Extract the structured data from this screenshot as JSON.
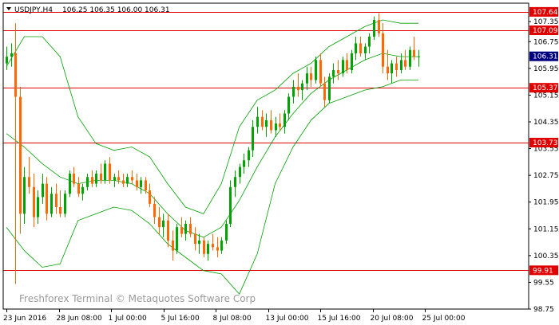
{
  "header": {
    "symbol": "USDJPY,H4",
    "ohlc": "106.25 106.35 106.00 106.31"
  },
  "watermark": "Freshforex Terminal © Metaquotes Software Corp",
  "colors": {
    "background": "#ffffff",
    "frame": "#000000",
    "bull_candle": "#00a400",
    "bear_candle": "#ff6a00",
    "level_line": "#e00000",
    "bollinger": "#00a000",
    "price_box": "#000080"
  },
  "chart_data": {
    "type": "candlestick",
    "ylim": [
      98.75,
      107.9
    ],
    "y_ticks": [
      "107.35",
      "106.75",
      "105.95",
      "105.15",
      "104.35",
      "103.55",
      "102.75",
      "101.95",
      "101.15",
      "100.35",
      "99.55",
      "98.75"
    ],
    "x_ticks": [
      "23 Jun 2016",
      "28 Jun 08:00",
      "1 Jul 00:00",
      "5 Jul 16:00",
      "8 Jul 08:00",
      "13 Jul 00:00",
      "15 Jul 16:00",
      "20 Jul 08:00",
      "25 Jul 00:00"
    ],
    "current_price": "106.31",
    "levels": [
      {
        "value": 107.64,
        "label": "107.64"
      },
      {
        "value": 107.09,
        "label": "107.09"
      },
      {
        "value": 105.37,
        "label": "105.37"
      },
      {
        "value": 103.73,
        "label": "103.73"
      },
      {
        "value": 99.91,
        "label": "99.91"
      }
    ],
    "candles": [
      [
        106.1,
        106.6,
        105.9,
        106.3
      ],
      [
        106.3,
        106.7,
        106.0,
        106.4
      ],
      [
        106.4,
        107.3,
        99.5,
        105.1
      ],
      [
        105.1,
        105.4,
        101.0,
        101.6
      ],
      [
        101.6,
        103.0,
        101.3,
        102.7
      ],
      [
        102.7,
        103.3,
        102.2,
        102.4
      ],
      [
        102.4,
        102.8,
        101.2,
        101.5
      ],
      [
        101.5,
        102.3,
        101.3,
        102.1
      ],
      [
        102.1,
        102.8,
        101.9,
        102.5
      ],
      [
        102.5,
        102.7,
        101.4,
        101.6
      ],
      [
        101.6,
        102.4,
        101.5,
        102.2
      ],
      [
        102.2,
        102.5,
        101.6,
        101.8
      ],
      [
        101.8,
        102.3,
        101.5,
        101.6
      ],
      [
        101.6,
        102.3,
        101.5,
        102.2
      ],
      [
        102.2,
        102.9,
        102.1,
        102.8
      ],
      [
        102.8,
        103.0,
        102.4,
        102.5
      ],
      [
        102.5,
        102.7,
        102.1,
        102.2
      ],
      [
        102.2,
        102.5,
        102.0,
        102.4
      ],
      [
        102.4,
        102.8,
        102.3,
        102.7
      ],
      [
        102.7,
        102.9,
        102.4,
        102.5
      ],
      [
        102.5,
        102.9,
        102.4,
        102.8
      ],
      [
        102.8,
        103.1,
        102.5,
        102.6
      ],
      [
        102.6,
        103.2,
        102.5,
        103.1
      ],
      [
        103.1,
        103.3,
        102.5,
        102.6
      ],
      [
        102.6,
        102.8,
        102.4,
        102.7
      ],
      [
        102.7,
        102.9,
        102.5,
        102.6
      ],
      [
        102.6,
        102.8,
        102.4,
        102.5
      ],
      [
        102.5,
        102.8,
        102.4,
        102.7
      ],
      [
        102.7,
        102.9,
        102.5,
        102.6
      ],
      [
        102.6,
        102.8,
        102.3,
        102.4
      ],
      [
        102.4,
        102.7,
        102.2,
        102.6
      ],
      [
        102.6,
        102.7,
        102.2,
        102.3
      ],
      [
        102.3,
        102.5,
        101.8,
        101.9
      ],
      [
        101.9,
        102.1,
        101.3,
        101.5
      ],
      [
        101.5,
        101.8,
        101.0,
        101.2
      ],
      [
        101.2,
        101.6,
        100.9,
        101.4
      ],
      [
        101.4,
        101.6,
        100.6,
        100.8
      ],
      [
        100.8,
        101.1,
        100.2,
        100.5
      ],
      [
        100.5,
        101.3,
        100.4,
        101.2
      ],
      [
        101.2,
        101.5,
        100.9,
        101.0
      ],
      [
        101.0,
        101.4,
        100.8,
        101.3
      ],
      [
        101.3,
        101.5,
        100.9,
        101.0
      ],
      [
        101.0,
        101.2,
        100.5,
        100.7
      ],
      [
        100.7,
        101.0,
        100.4,
        100.8
      ],
      [
        100.8,
        100.9,
        100.3,
        100.4
      ],
      [
        100.4,
        100.8,
        100.2,
        100.7
      ],
      [
        100.7,
        101.0,
        100.5,
        100.6
      ],
      [
        100.6,
        100.9,
        100.3,
        100.5
      ],
      [
        100.5,
        100.9,
        100.4,
        100.8
      ],
      [
        100.8,
        101.4,
        100.7,
        101.3
      ],
      [
        101.3,
        102.6,
        101.2,
        102.4
      ],
      [
        102.4,
        102.9,
        102.1,
        102.7
      ],
      [
        102.7,
        103.1,
        102.5,
        103.0
      ],
      [
        103.0,
        103.4,
        102.8,
        103.2
      ],
      [
        103.2,
        103.6,
        103.0,
        103.5
      ],
      [
        103.5,
        104.4,
        103.3,
        104.2
      ],
      [
        104.2,
        104.8,
        104.0,
        104.5
      ],
      [
        104.5,
        104.7,
        104.1,
        104.2
      ],
      [
        104.2,
        104.6,
        103.9,
        104.4
      ],
      [
        104.4,
        104.7,
        104.0,
        104.1
      ],
      [
        104.1,
        104.5,
        103.9,
        104.3
      ],
      [
        104.3,
        104.6,
        104.1,
        104.2
      ],
      [
        104.2,
        104.7,
        104.0,
        104.6
      ],
      [
        104.6,
        105.2,
        104.4,
        105.1
      ],
      [
        105.1,
        105.6,
        104.9,
        105.4
      ],
      [
        105.4,
        105.8,
        105.1,
        105.3
      ],
      [
        105.3,
        105.6,
        105.0,
        105.5
      ],
      [
        105.5,
        106.0,
        105.3,
        105.8
      ],
      [
        105.8,
        106.0,
        105.4,
        105.6
      ],
      [
        105.6,
        106.3,
        105.5,
        106.2
      ],
      [
        106.2,
        106.4,
        105.4,
        105.5
      ],
      [
        105.5,
        105.7,
        104.8,
        105.0
      ],
      [
        105.0,
        105.8,
        104.9,
        105.7
      ],
      [
        105.7,
        106.1,
        105.5,
        105.9
      ],
      [
        105.9,
        106.2,
        105.6,
        105.8
      ],
      [
        105.8,
        106.3,
        105.7,
        106.2
      ],
      [
        106.2,
        106.4,
        105.8,
        105.9
      ],
      [
        105.9,
        106.5,
        105.8,
        106.4
      ],
      [
        106.4,
        106.9,
        106.2,
        106.7
      ],
      [
        106.7,
        106.9,
        106.3,
        106.4
      ],
      [
        106.4,
        106.7,
        106.2,
        106.6
      ],
      [
        106.6,
        107.0,
        106.4,
        106.9
      ],
      [
        106.9,
        107.5,
        106.8,
        107.4
      ],
      [
        107.4,
        107.6,
        106.9,
        107.0
      ],
      [
        107.0,
        107.3,
        105.8,
        106.0
      ],
      [
        106.0,
        106.5,
        105.6,
        105.8
      ],
      [
        105.8,
        106.2,
        105.5,
        106.1
      ],
      [
        106.1,
        106.3,
        105.7,
        105.9
      ],
      [
        105.9,
        106.4,
        105.8,
        106.2
      ],
      [
        106.2,
        106.5,
        105.9,
        106.0
      ],
      [
        106.0,
        106.6,
        105.9,
        106.5
      ],
      [
        106.5,
        106.9,
        106.2,
        106.3
      ],
      [
        106.3,
        106.5,
        106.0,
        106.31
      ]
    ],
    "bollinger": {
      "upper": [
        [
          0,
          106.0
        ],
        [
          4,
          106.9
        ],
        [
          8,
          106.9
        ],
        [
          12,
          106.3
        ],
        [
          16,
          104.5
        ],
        [
          20,
          103.7
        ],
        [
          24,
          103.5
        ],
        [
          28,
          103.6
        ],
        [
          32,
          103.3
        ],
        [
          36,
          102.5
        ],
        [
          40,
          101.8
        ],
        [
          44,
          101.6
        ],
        [
          48,
          102.5
        ],
        [
          52,
          104.2
        ],
        [
          56,
          105.0
        ],
        [
          60,
          105.3
        ],
        [
          64,
          105.8
        ],
        [
          68,
          106.1
        ],
        [
          72,
          106.6
        ],
        [
          76,
          106.9
        ],
        [
          80,
          107.2
        ],
        [
          84,
          107.4
        ],
        [
          88,
          107.3
        ],
        [
          92,
          107.3
        ]
      ],
      "lower": [
        [
          0,
          101.2
        ],
        [
          4,
          100.5
        ],
        [
          8,
          100.0
        ],
        [
          12,
          100.1
        ],
        [
          16,
          101.4
        ],
        [
          20,
          101.6
        ],
        [
          24,
          101.8
        ],
        [
          28,
          101.7
        ],
        [
          32,
          101.3
        ],
        [
          36,
          100.7
        ],
        [
          40,
          100.3
        ],
        [
          44,
          99.9
        ],
        [
          48,
          99.8
        ],
        [
          52,
          99.2
        ],
        [
          56,
          100.4
        ],
        [
          60,
          102.5
        ],
        [
          64,
          103.6
        ],
        [
          68,
          104.4
        ],
        [
          72,
          104.9
        ],
        [
          76,
          105.1
        ],
        [
          80,
          105.3
        ],
        [
          84,
          105.4
        ],
        [
          88,
          105.6
        ],
        [
          92,
          105.6
        ]
      ],
      "middle": [
        [
          0,
          104.0
        ],
        [
          4,
          103.6
        ],
        [
          8,
          103.1
        ],
        [
          12,
          102.7
        ],
        [
          16,
          102.5
        ],
        [
          20,
          102.6
        ],
        [
          24,
          102.6
        ],
        [
          28,
          102.5
        ],
        [
          32,
          102.2
        ],
        [
          36,
          101.6
        ],
        [
          40,
          101.1
        ],
        [
          44,
          100.9
        ],
        [
          48,
          101.2
        ],
        [
          52,
          102.0
        ],
        [
          56,
          103.0
        ],
        [
          60,
          103.9
        ],
        [
          64,
          104.6
        ],
        [
          68,
          105.2
        ],
        [
          72,
          105.6
        ],
        [
          76,
          105.9
        ],
        [
          80,
          106.2
        ],
        [
          84,
          106.4
        ],
        [
          88,
          106.3
        ],
        [
          92,
          106.3
        ]
      ]
    }
  }
}
